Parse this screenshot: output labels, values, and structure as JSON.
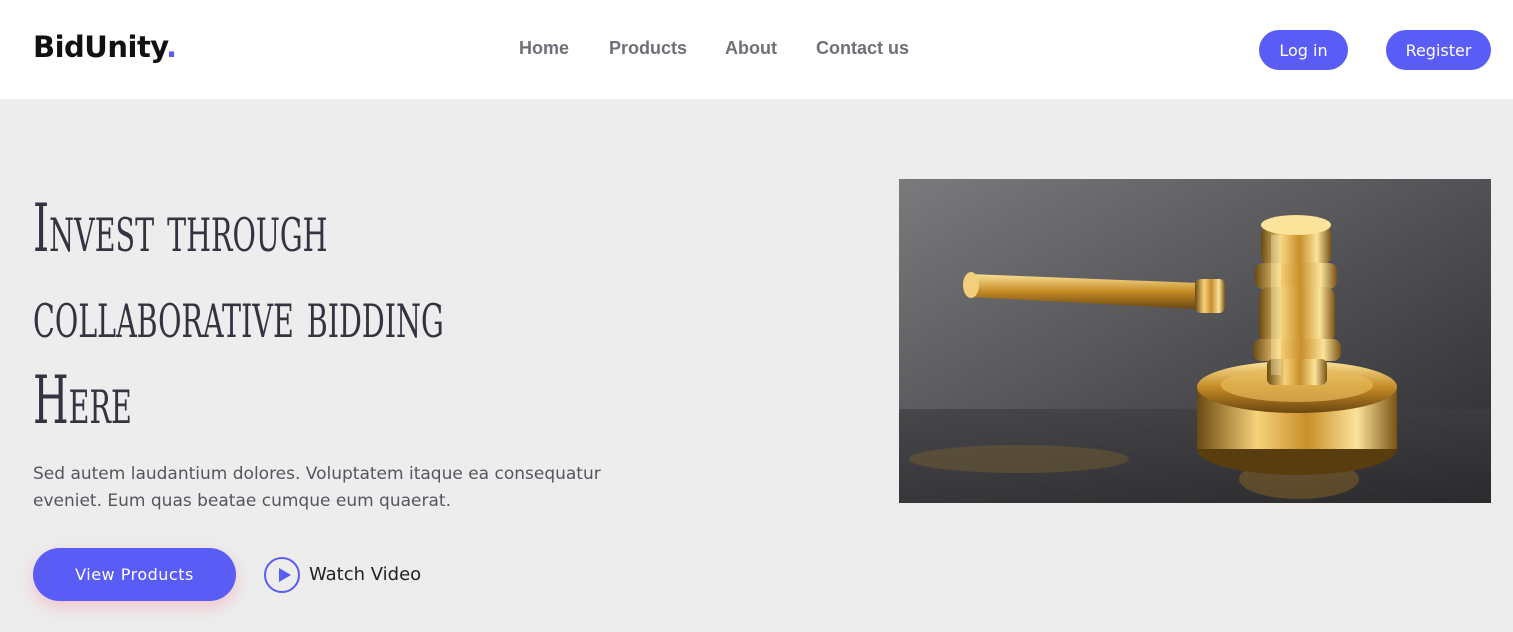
{
  "header": {
    "logo": {
      "text": "BidUnity",
      "dot": "."
    },
    "nav": [
      {
        "label": "Home"
      },
      {
        "label": "Products"
      },
      {
        "label": "About"
      },
      {
        "label": "Contact us"
      }
    ],
    "login_label": "Log in",
    "register_label": "Register"
  },
  "hero": {
    "title_lines": [
      "Invest through",
      "collaborative bidding",
      "Here"
    ],
    "description": "Sed autem laudantium dolores. Voluptatem itaque ea consequatur eveniet. Eum quas beatae cumque eum quaerat.",
    "primary_button": "View Products",
    "watch_video_label": "Watch Video",
    "image": {
      "icon": "gavel-image"
    }
  },
  "colors": {
    "accent": "#5a5cf6",
    "header_bg": "#ffffff",
    "page_bg": "#ededed",
    "nav_text": "#6f6f78",
    "heading_text": "#343440"
  }
}
